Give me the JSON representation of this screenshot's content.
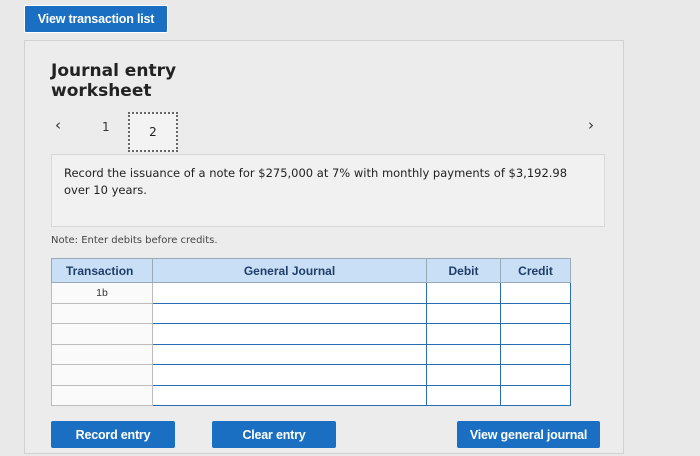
{
  "header": {
    "view_transaction_list": "View transaction list"
  },
  "worksheet": {
    "title_line1": "Journal entry",
    "title_line2": "worksheet",
    "pages": [
      "1",
      "2"
    ],
    "current_page": "2",
    "description": "Record the issuance of a note for $275,000 at 7% with monthly payments of $3,192.98 over 10 years.",
    "note": "Note: Enter debits before credits."
  },
  "table": {
    "headers": [
      "Transaction",
      "General Journal",
      "Debit",
      "Credit"
    ],
    "rows": [
      {
        "transaction": "1b",
        "account": "",
        "debit": "",
        "credit": ""
      },
      {
        "transaction": "",
        "account": "",
        "debit": "",
        "credit": ""
      },
      {
        "transaction": "",
        "account": "",
        "debit": "",
        "credit": ""
      },
      {
        "transaction": "",
        "account": "",
        "debit": "",
        "credit": ""
      },
      {
        "transaction": "",
        "account": "",
        "debit": "",
        "credit": ""
      },
      {
        "transaction": "",
        "account": "",
        "debit": "",
        "credit": ""
      }
    ]
  },
  "buttons": {
    "record_entry": "Record entry",
    "clear_entry": "Clear entry",
    "view_general_journal": "View general journal"
  },
  "colors": {
    "accent": "#1b6fc2",
    "header_bg": "#c9dff5"
  },
  "icons": {
    "prev": "chevron-left-icon",
    "next": "chevron-right-icon"
  }
}
